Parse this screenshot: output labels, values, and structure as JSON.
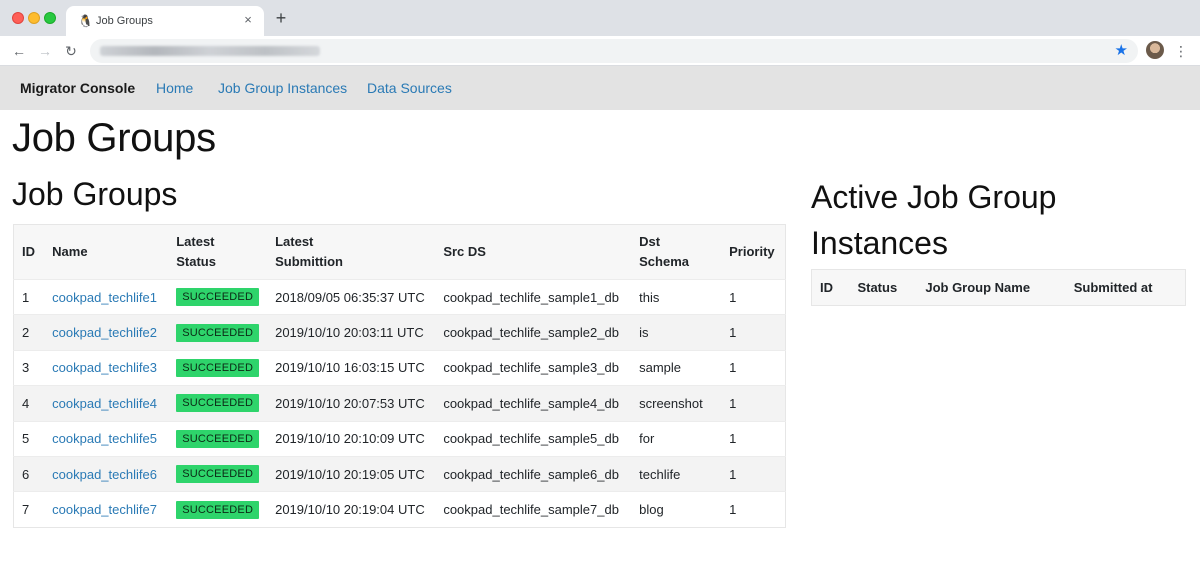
{
  "browser": {
    "tab_title": "Job Groups",
    "tab_favicon": "penguin-icon",
    "close_glyph": "×",
    "new_tab_glyph": "+",
    "back_glyph": "←",
    "forward_glyph": "→",
    "reload_glyph": "↻",
    "star_glyph": "★",
    "menu_glyph": "⋮",
    "accent_color": "#1a73e8"
  },
  "navbar": {
    "brand": "Migrator Console",
    "links": [
      {
        "label": "Home"
      },
      {
        "label": "Job Group Instances"
      },
      {
        "label": "Data Sources"
      }
    ]
  },
  "page": {
    "title": "Job Groups"
  },
  "job_groups": {
    "heading": "Job Groups",
    "columns": {
      "id": "ID",
      "name": "Name",
      "status_l1": "Latest",
      "status_l2": "Status",
      "sub_l1": "Latest",
      "sub_l2": "Submittion",
      "src": "Src DS",
      "dst": "Dst Schema",
      "priority": "Priority"
    },
    "status_color": "#2ed46b",
    "rows": [
      {
        "id": "1",
        "name": "cookpad_techlife1",
        "status": "SUCCEEDED",
        "submitted": "2018/09/05 06:35:37 UTC",
        "src": "cookpad_techlife_sample1_db",
        "dst": "this",
        "priority": "1"
      },
      {
        "id": "2",
        "name": "cookpad_techlife2",
        "status": "SUCCEEDED",
        "submitted": "2019/10/10 20:03:11 UTC",
        "src": "cookpad_techlife_sample2_db",
        "dst": "is",
        "priority": "1"
      },
      {
        "id": "3",
        "name": "cookpad_techlife3",
        "status": "SUCCEEDED",
        "submitted": "2019/10/10 16:03:15 UTC",
        "src": "cookpad_techlife_sample3_db",
        "dst": "sample",
        "priority": "1"
      },
      {
        "id": "4",
        "name": "cookpad_techlife4",
        "status": "SUCCEEDED",
        "submitted": "2019/10/10 20:07:53 UTC",
        "src": "cookpad_techlife_sample4_db",
        "dst": "screenshot",
        "priority": "1"
      },
      {
        "id": "5",
        "name": "cookpad_techlife5",
        "status": "SUCCEEDED",
        "submitted": "2019/10/10 20:10:09 UTC",
        "src": "cookpad_techlife_sample5_db",
        "dst": "for",
        "priority": "1"
      },
      {
        "id": "6",
        "name": "cookpad_techlife6",
        "status": "SUCCEEDED",
        "submitted": "2019/10/10 20:19:05 UTC",
        "src": "cookpad_techlife_sample6_db",
        "dst": "techlife",
        "priority": "1"
      },
      {
        "id": "7",
        "name": "cookpad_techlife7",
        "status": "SUCCEEDED",
        "submitted": "2019/10/10 20:19:04 UTC",
        "src": "cookpad_techlife_sample7_db",
        "dst": "blog",
        "priority": "1"
      }
    ]
  },
  "active_instances": {
    "heading": "Active Job Group Instances",
    "columns": {
      "id": "ID",
      "status": "Status",
      "job_group_name": "Job Group Name",
      "submitted_at": "Submitted at"
    }
  }
}
